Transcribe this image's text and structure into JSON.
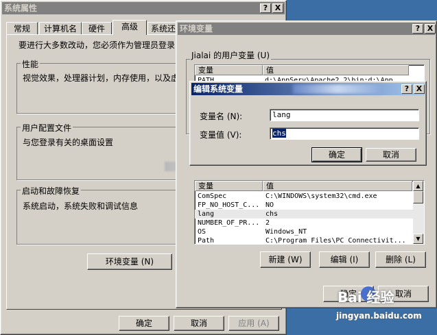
{
  "sysprops": {
    "title": "系统属性",
    "help_btn": "?",
    "close_btn": "X",
    "tabs": [
      "常规",
      "计算机名",
      "硬件",
      "高级",
      "系统还"
    ],
    "admin_note": "要进行大多数改动，您必须作为管理员登录",
    "perf": {
      "legend": "性能",
      "text": "视觉效果，处理器计划，内存使用，以及虚"
    },
    "profile": {
      "legend": "用户配置文件",
      "text": "与您登录有关的桌面设置"
    },
    "startup": {
      "legend": "启动和故障恢复",
      "text": "系统启动，系统失败和调试信息"
    },
    "env_btn": "环境变量 (N)",
    "ok": "确定",
    "cancel": "取消",
    "apply": "应用 (A)"
  },
  "envvars": {
    "title": "环境变量",
    "help_btn": "?",
    "close_btn": "X",
    "user_group": "Jialai 的用户变量 (U)",
    "col_var": "变量",
    "col_val": "值",
    "user_rows": [
      {
        "name": "PATH",
        "value": "d:\\AppServ\\Apache2.2\\bin;d:\\App"
      }
    ],
    "sys_rows": [
      {
        "name": "ComSpec",
        "value": "C:\\WINDOWS\\system32\\cmd.exe"
      },
      {
        "name": "FP_NO_HOST_C...",
        "value": "NO"
      },
      {
        "name": "lang",
        "value": "chs"
      },
      {
        "name": "NUMBER_OF_PR...",
        "value": "2"
      },
      {
        "name": "OS",
        "value": "Windows_NT"
      },
      {
        "name": "Path",
        "value": "C:\\Program Files\\PC Connectivit..."
      }
    ],
    "new_btn": "新建 (W)",
    "edit_btn": "编辑 (I)",
    "delete_btn": "删除 (L)",
    "ok": "确定",
    "cancel": "取消"
  },
  "editdlg": {
    "title": "编辑系统变量",
    "help_btn": "?",
    "close_btn": "X",
    "name_label": "变量名 (N):",
    "value_label": "变量值 (V):",
    "name_value": "lang",
    "value_value": "chs",
    "ok": "确定",
    "cancel": "取消"
  },
  "watermark": {
    "brand": "Bai 经验",
    "site": "jingyan.baidu.com"
  },
  "colors": {
    "desktop": "#3a6ea5",
    "active_title": "#0a246a",
    "face": "#d4d0c8",
    "selection": "#0a246a"
  }
}
